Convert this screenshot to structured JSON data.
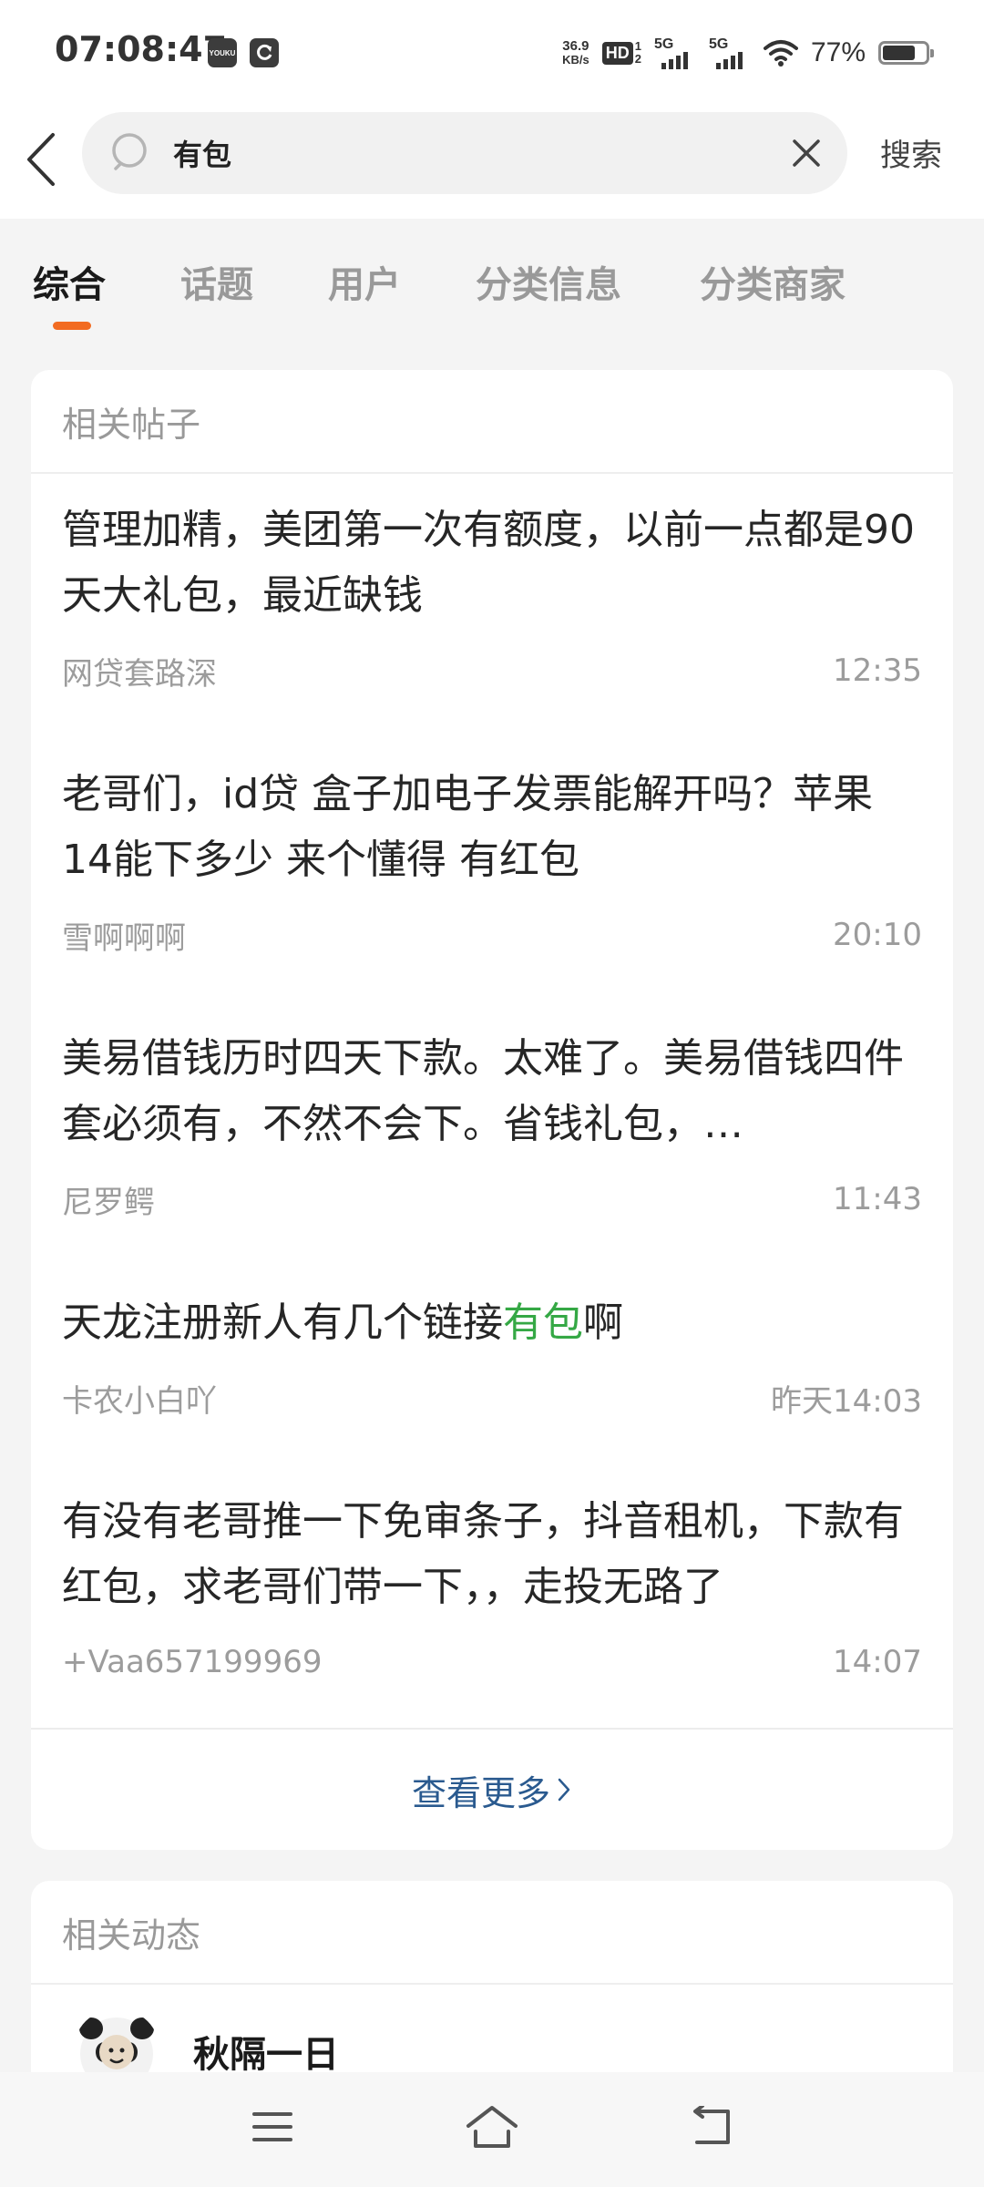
{
  "status_bar": {
    "time": "07:08:47",
    "app_icons": [
      "youku-icon",
      "refresh-app-icon"
    ],
    "youku_text": "YOUKU",
    "net_speed_value": "36.9",
    "net_speed_unit": "KB/s",
    "hd_label": "HD",
    "hd_sub_top": "1",
    "hd_sub_bottom": "2",
    "signal_1_label": "5G",
    "signal_2_label": "5G",
    "battery_percent": "77%",
    "battery_level": 0.77
  },
  "search": {
    "query": "有包",
    "button_label": "搜索"
  },
  "tabs": [
    {
      "label": "综合",
      "active": true
    },
    {
      "label": "话题",
      "active": false
    },
    {
      "label": "用户",
      "active": false
    },
    {
      "label": "分类信息",
      "active": false
    },
    {
      "label": "分类商家",
      "active": false
    }
  ],
  "accent_color": "#f26b21",
  "highlight_color": "#35a845",
  "posts_section": {
    "header": "相关帖子",
    "posts": [
      {
        "title": "管理加精，美团第一次有额度，以前一点都是90天大礼包，最近缺钱",
        "author": "网贷套路深",
        "time": "12:35"
      },
      {
        "title": "老哥们，id贷 盒子加电子发票能解开吗？苹果14能下多少 来个懂得 有红包",
        "author": "雪啊啊啊",
        "time": "20:10"
      },
      {
        "title": "美易借钱历时四天下款。太难了。美易借钱四件套必须有，不然不会下。省钱礼包，…",
        "author": "尼罗鳄",
        "time": "11:43"
      },
      {
        "title_before": "天龙注册新人有几个链接",
        "title_highlight": "有包",
        "title_after": "啊",
        "author": "卡农小白吖",
        "time": "昨天14:03"
      },
      {
        "title": "有没有老哥推一下免审条子，抖音租机，下款有红包，求老哥们带一下，，走投无路了",
        "author": "+Vaa657199969",
        "time": "14:07"
      }
    ],
    "more_label": "查看更多"
  },
  "feed_section": {
    "header": "相关动态",
    "username": "秋隔一日"
  },
  "nav_bar": {
    "buttons": [
      "menu-icon",
      "home-icon",
      "back-icon"
    ]
  }
}
